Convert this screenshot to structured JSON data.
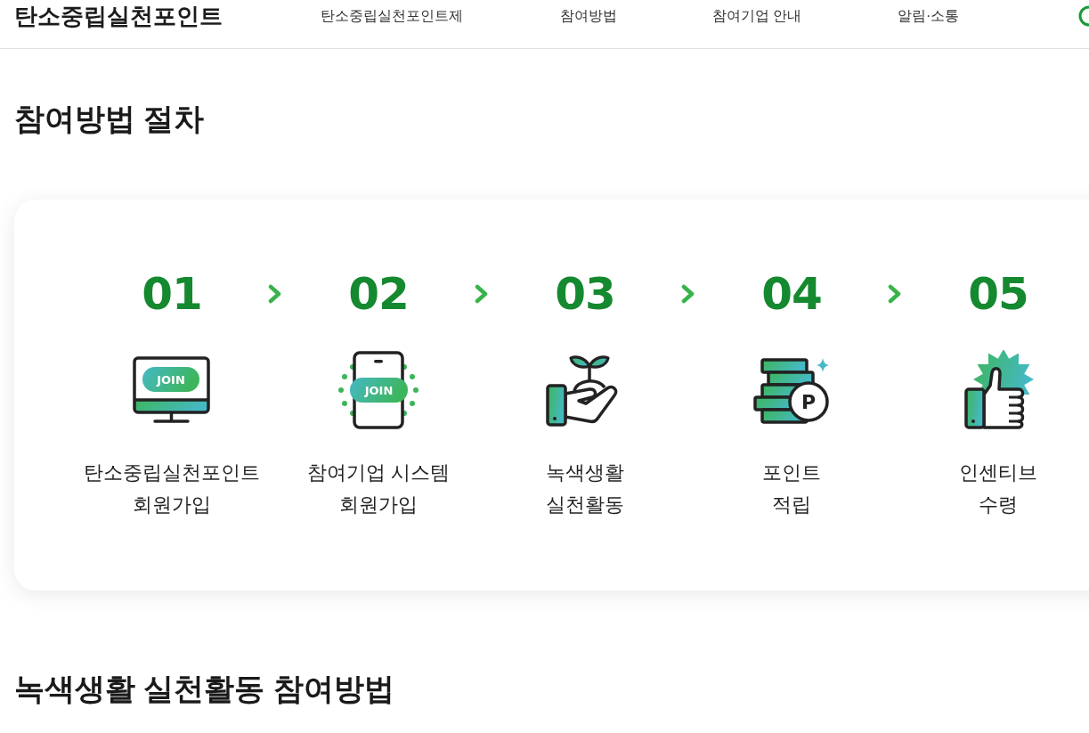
{
  "header": {
    "logo": "탄소중립실천포인트",
    "nav": [
      "탄소중립실천포인트제",
      "참여방법",
      "참여기업 안내",
      "알림·소통"
    ]
  },
  "procedure": {
    "title": "참여방법 절차",
    "steps": [
      {
        "number": "01",
        "kind": "monitor",
        "icon_text": "JOIN",
        "label": [
          "탄소중립실천포인트",
          "회원가입"
        ]
      },
      {
        "number": "02",
        "kind": "phone",
        "icon_text": "JOIN",
        "label": [
          "참여기업 시스템",
          "회원가입"
        ]
      },
      {
        "number": "03",
        "kind": "sprout-hand",
        "label": [
          "녹색생활",
          "실천활동"
        ]
      },
      {
        "number": "04",
        "kind": "coins",
        "icon_text": "P",
        "label": [
          "포인트",
          "적립"
        ]
      },
      {
        "number": "05",
        "kind": "thumbs-up",
        "label": [
          "인센티브",
          "수령"
        ]
      }
    ]
  },
  "next_section": {
    "title": "녹색생활 실천활동 참여방법"
  }
}
